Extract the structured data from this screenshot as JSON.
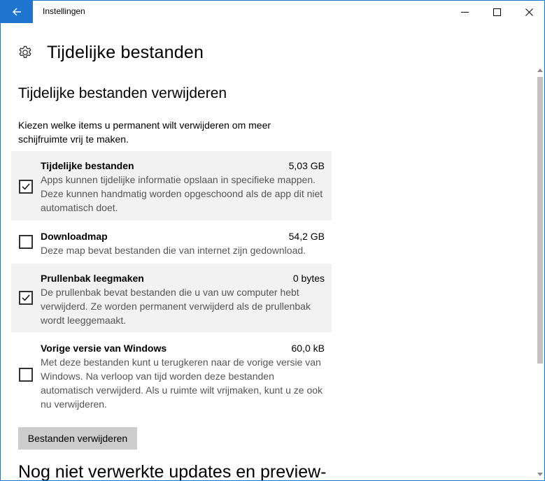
{
  "window": {
    "app_title": "Instellingen"
  },
  "header": {
    "title": "Tijdelijke bestanden",
    "icon": "gear-icon"
  },
  "section": {
    "title": "Tijdelijke bestanden verwijderen",
    "description": "Kiezen welke items u permanent wilt verwijderen om meer schijfruimte vrij te maken."
  },
  "items": [
    {
      "name": "Tijdelijke bestanden",
      "size": "5,03 GB",
      "description": "Apps kunnen tijdelijke informatie opslaan in specifieke mappen. Deze kunnen handmatig worden opgeschoond als de app dit niet automatisch doet.",
      "checked": true
    },
    {
      "name": "Downloadmap",
      "size": "54,2 GB",
      "description": "Deze map bevat bestanden die van internet zijn gedownload.",
      "checked": false
    },
    {
      "name": "Prullenbak leegmaken",
      "size": "0 bytes",
      "description": "De prullenbak bevat bestanden die u van uw computer hebt verwijderd. Ze worden permanent verwijderd als de prullenbak wordt leeggemaakt.",
      "checked": true
    },
    {
      "name": "Vorige versie van Windows",
      "size": "60,0 kB",
      "description": "Met deze bestanden kunt u terugkeren naar de vorige versie van Windows. Na verloop van tijd worden deze bestanden automatisch verwijderd. Als u ruimte wilt vrijmaken, kunt u ze ook nu verwijderen.",
      "checked": false
    }
  ],
  "actions": {
    "remove_label": "Bestanden verwijderen"
  },
  "next_section": {
    "title": "Nog niet verwerkte updates en preview-"
  },
  "colors": {
    "accent": "#1e75d0",
    "checked_bg": "#f2f2f2",
    "button_bg": "#cccccc"
  }
}
